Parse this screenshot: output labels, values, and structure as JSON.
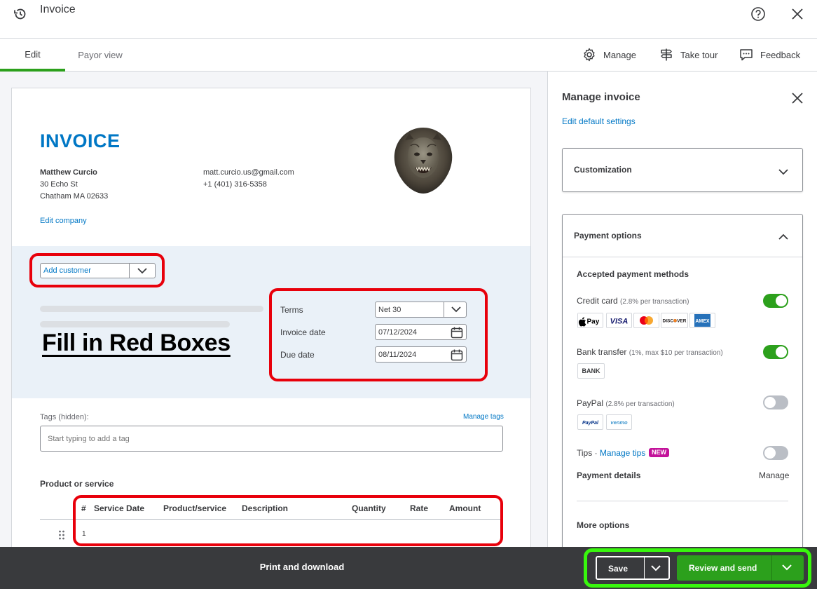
{
  "header": {
    "title": "Invoice",
    "history_icon": "history-icon",
    "help_icon": "help-icon",
    "close_icon": "close-icon"
  },
  "tabs": [
    {
      "label": "Edit",
      "active": true
    },
    {
      "label": "Payor view",
      "active": false
    }
  ],
  "toolbar": {
    "manage_label": "Manage",
    "take_tour_label": "Take tour",
    "feedback_label": "Feedback"
  },
  "invoice": {
    "heading": "INVOICE",
    "company": {
      "name": "Matthew Curcio",
      "address_line1": "30 Echo St",
      "address_line2": "Chatham MA 02633",
      "email": "matt.curcio.us@gmail.com",
      "phone": "+1 (401) 316-5358",
      "edit_link": "Edit company"
    },
    "customer": {
      "placeholder": "Add customer"
    },
    "annotation_text": "Fill in Red Boxes",
    "terms": {
      "terms_label": "Terms",
      "terms_value": "Net 30",
      "invoice_date_label": "Invoice date",
      "invoice_date_value": "07/12/2024",
      "due_date_label": "Due date",
      "due_date_value": "08/11/2024"
    },
    "tags": {
      "label": "Tags (hidden):",
      "manage_link": "Manage tags",
      "placeholder": "Start typing to add a tag"
    },
    "products": {
      "title": "Product or service",
      "columns": [
        "#",
        "Service Date",
        "Product/service",
        "Description",
        "Quantity",
        "Rate",
        "Amount"
      ],
      "rows": [
        {
          "number": "1"
        }
      ]
    }
  },
  "manage_panel": {
    "title": "Manage invoice",
    "edit_defaults_link": "Edit default settings",
    "customization_label": "Customization",
    "payment_options_label": "Payment options",
    "accepted_methods_label": "Accepted payment methods",
    "credit_card": {
      "label": "Credit card",
      "note": "(2.8% per transaction)",
      "enabled": true,
      "badges": [
        "Pay",
        "VISA",
        "DISCOVER",
        "AMEX"
      ]
    },
    "bank_transfer": {
      "label": "Bank transfer",
      "note": "(1%, max $10 per transaction)",
      "enabled": true,
      "badge": "BANK"
    },
    "paypal": {
      "label": "PayPal",
      "note": "(2.8% per transaction)",
      "enabled": false,
      "badges": [
        "PayPal",
        "venmo"
      ]
    },
    "tips": {
      "label": "Tips",
      "separator": "·",
      "manage_link": "Manage tips",
      "new_badge": "NEW",
      "enabled": false
    },
    "payment_details_label": "Payment details",
    "payment_details_link": "Manage",
    "more_options_label": "More options"
  },
  "footer": {
    "print_label": "Print and download",
    "save_label": "Save",
    "review_label": "Review and send"
  },
  "colors": {
    "brand_green": "#2ca01c",
    "link_blue": "#0077c5",
    "annotation_red": "#e8000b",
    "annotation_green": "#38f70d",
    "footer_dark": "#393a3d"
  }
}
